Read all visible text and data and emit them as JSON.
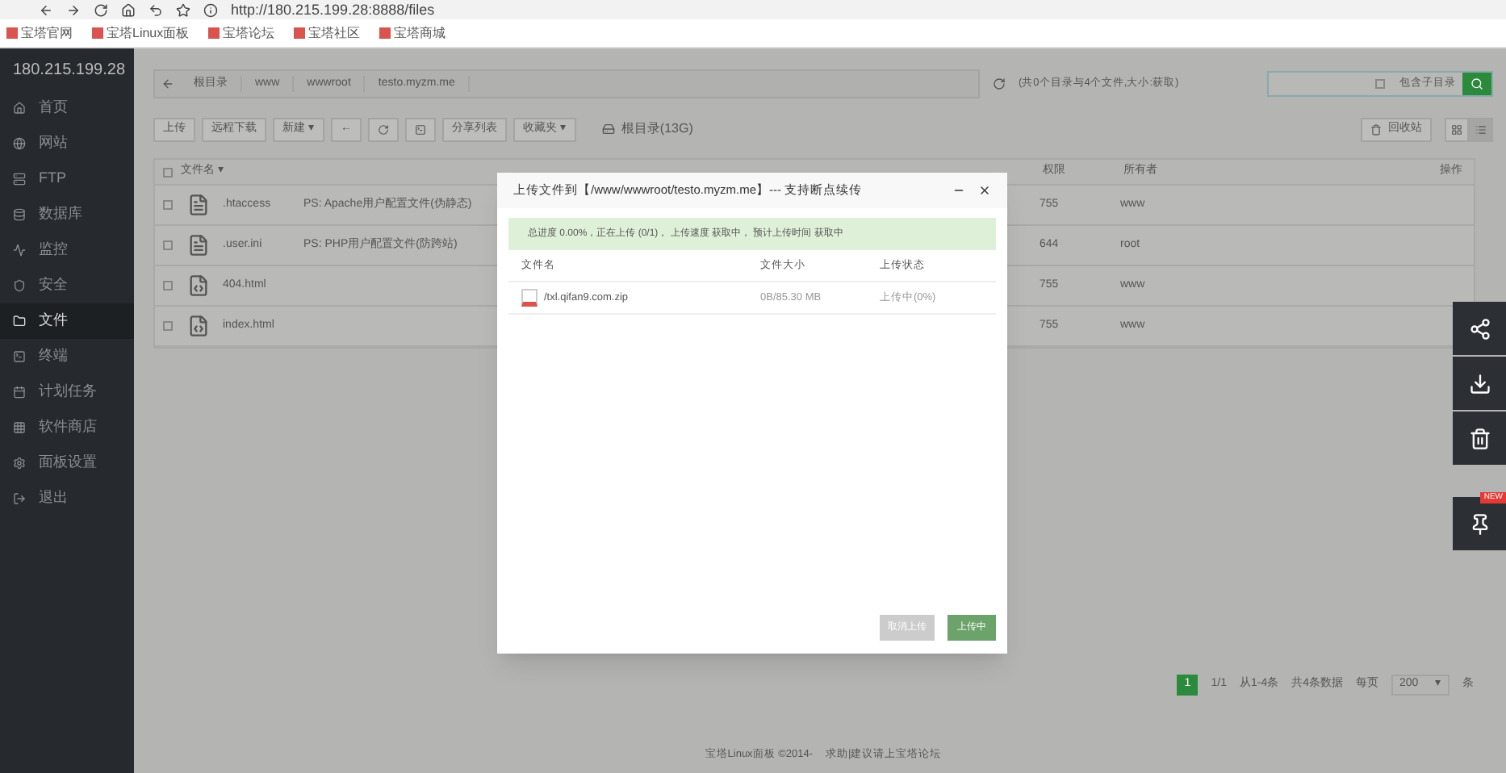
{
  "browser": {
    "url": "http://180.215.199.28:8888/files",
    "bookmarks": [
      "宝塔官网",
      "宝塔Linux面板",
      "宝塔论坛",
      "宝塔社区",
      "宝塔商城"
    ]
  },
  "sidebar": {
    "host": "180.215.199.28",
    "items": [
      {
        "label": "首页",
        "selected": false
      },
      {
        "label": "网站",
        "selected": false
      },
      {
        "label": "FTP",
        "selected": false
      },
      {
        "label": "数据库",
        "selected": false
      },
      {
        "label": "监控",
        "selected": false
      },
      {
        "label": "安全",
        "selected": false
      },
      {
        "label": "文件",
        "selected": true
      },
      {
        "label": "终端",
        "selected": false
      },
      {
        "label": "计划任务",
        "selected": false
      },
      {
        "label": "软件商店",
        "selected": false
      },
      {
        "label": "面板设置",
        "selected": false
      },
      {
        "label": "退出",
        "selected": false
      }
    ]
  },
  "path": {
    "crumbs": [
      "根目录",
      "www",
      "wwwroot",
      "testo.myzm.me"
    ],
    "summary": "(共0个目录与4个文件,大小:获取)",
    "search_option": "包含子目录",
    "search_option_checked": false
  },
  "toolbar": {
    "buttons": [
      {
        "label": "上传",
        "kind": "text"
      },
      {
        "label": "远程下载",
        "kind": "text"
      },
      {
        "label": "新建 ▾",
        "kind": "text"
      },
      {
        "label": "←",
        "kind": "text"
      },
      {
        "kind": "refresh"
      },
      {
        "kind": "terminal"
      },
      {
        "label": "分享列表",
        "kind": "text"
      },
      {
        "label": "收藏夹 ▾",
        "kind": "text"
      }
    ],
    "disk": "根目录(13G)",
    "recycle": "回收站",
    "views": [
      {
        "kind": "grid",
        "selected": false
      },
      {
        "kind": "list",
        "selected": true
      }
    ]
  },
  "table": {
    "columns": [
      "文件名 ▾",
      "权限",
      "所有者",
      "操作"
    ],
    "all_checked": false,
    "rows": [
      {
        "kind": "file",
        "checked": false,
        "name": ".htaccess",
        "note": "PS: Apache用户配置文件(伪静态)",
        "perm": "755",
        "owner": "www"
      },
      {
        "kind": "file",
        "checked": false,
        "name": ".user.ini",
        "note": "PS: PHP用户配置文件(防跨站)",
        "perm": "644",
        "owner": "root"
      },
      {
        "kind": "html",
        "checked": false,
        "name": "404.html",
        "perm": "755",
        "owner": "www"
      },
      {
        "kind": "html",
        "checked": false,
        "name": "index.html",
        "perm": "755",
        "owner": "www"
      }
    ]
  },
  "pagination": {
    "pages": [
      {
        "label": "1",
        "selected": true
      }
    ],
    "page_info": "1/1",
    "range": "从1-4条",
    "total": "共4条数据",
    "per_page_label": "每页",
    "per_page": "200",
    "per_page_arrow": "▾",
    "unit": "条"
  },
  "footer": {
    "text": "宝塔Linux面板 ©2014-",
    "link": "求助|建议请上宝塔论坛"
  },
  "dialog": {
    "title": "上传文件到【/www/wwwroot/testo.myzm.me】--- 支持断点续传",
    "progress": "总进度 0.00%，正在上传 (0/1)，  上传速度 获取中，  预计上传时间 获取中",
    "columns": [
      "文件名",
      "文件大小",
      "上传状态"
    ],
    "files": [
      {
        "name": "/txl.qifan9.com.zip",
        "size": "0B/85.30 MB",
        "status": "上传中(0%)"
      }
    ],
    "cancel": "取消上传",
    "upload": "上传中"
  },
  "float_tools": [
    {
      "kind": "share"
    },
    {
      "kind": "download"
    },
    {
      "kind": "trash"
    },
    {
      "kind": "pin",
      "badge": "NEW"
    }
  ]
}
